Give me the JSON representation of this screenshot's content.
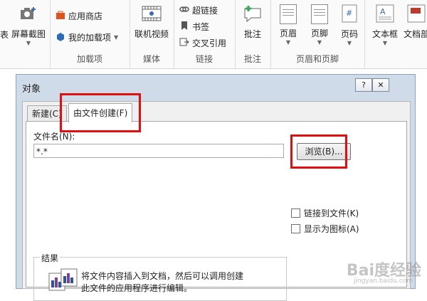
{
  "ribbon": {
    "groups": [
      {
        "label": "加载项"
      },
      {
        "label": "媒体"
      },
      {
        "label": "链接"
      },
      {
        "label": "批注"
      },
      {
        "label": "页眉和页脚"
      }
    ],
    "cut_label": "表",
    "screenshot": "屏幕截图",
    "app_store": "应用商店",
    "my_addins": "我的加载项",
    "online_video": "联机视频",
    "hyperlink": "超链接",
    "bookmark": "书签",
    "cross_ref": "交叉引用",
    "comment": "批注",
    "header": "页眉",
    "footer": "页脚",
    "page_number": "页码",
    "textbox": "文本框",
    "docpart": "文档部"
  },
  "dialog": {
    "title": "对象",
    "help": "?",
    "close": "✕",
    "tab_new": "新建(C)",
    "tab_from_file": "由文件创建(F)",
    "filename_label": "文件名(N):",
    "filename_value": "*.*",
    "browse": "浏览(B)...",
    "link_to_file": "链接到文件(K)",
    "display_as_icon": "显示为图标(A)",
    "result_title": "结果",
    "result_line1": "将文件内容插入到文档，然后可以调用创建",
    "result_line2": "此文件的应用程序进行编辑。"
  },
  "watermark": {
    "brand": "Bai度经验",
    "url": "jingyan.baidu.com"
  },
  "colors": {
    "highlight": "#e01010",
    "dialog_frame": "#cfdbe8"
  }
}
